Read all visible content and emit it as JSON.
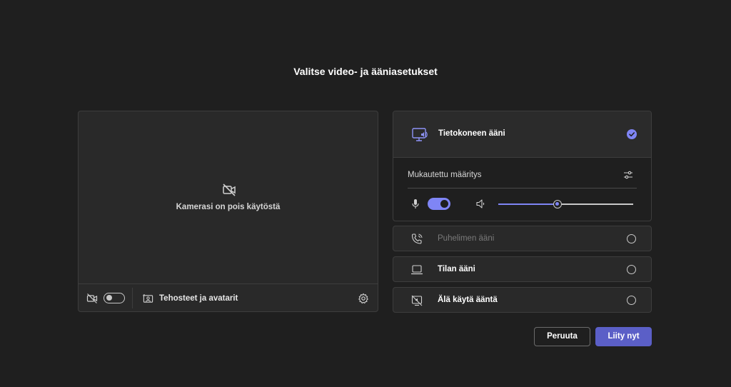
{
  "page": {
    "title": "Valitse video- ja ääniasetukset"
  },
  "video": {
    "camera_off_text": "Kamerasi on pois käytöstä",
    "camera_toggle_on": false,
    "effects_label": "Tehosteet ja avatarit"
  },
  "audio": {
    "selected_option": {
      "label": "Tietokoneen ääni",
      "selected": true,
      "custom_label": "Mukautettu määritys",
      "mic_on": true,
      "volume_fraction": 0.44
    },
    "options": [
      {
        "label": "Puhelimen ääni",
        "icon": "phone-audio-icon",
        "disabled": true
      },
      {
        "label": "Tilan ääni",
        "icon": "room-audio-icon",
        "disabled": false
      },
      {
        "label": "Älä käytä ääntä",
        "icon": "no-audio-icon",
        "disabled": false
      }
    ]
  },
  "actions": {
    "cancel_label": "Peruuta",
    "join_label": "Liity nyt"
  },
  "colors": {
    "background": "#1f1f1f",
    "panel": "#292929",
    "accent": "#7f85f5",
    "primary_button": "#5b5fc7"
  }
}
